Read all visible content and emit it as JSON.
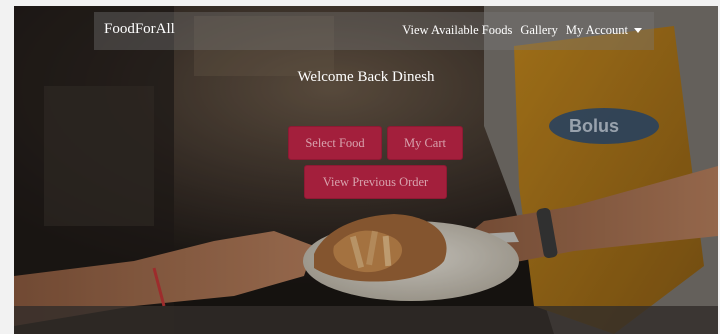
{
  "navbar": {
    "brand": "FoodForAll",
    "links": [
      {
        "label": "View Available Foods"
      },
      {
        "label": "Gallery"
      },
      {
        "label": "My Account",
        "has_dropdown": true,
        "icon": "caret-down-icon"
      }
    ]
  },
  "hero": {
    "welcome_text": "Welcome Back Dinesh",
    "image": "food-being-served-photo"
  },
  "actions": {
    "select_food": "Select Food",
    "my_cart": "My Cart",
    "view_previous_order": "View Previous Order"
  },
  "colors": {
    "button_bg": "#a31f3c",
    "button_text": "#d8a3ae",
    "nav_text": "#ffffff"
  }
}
